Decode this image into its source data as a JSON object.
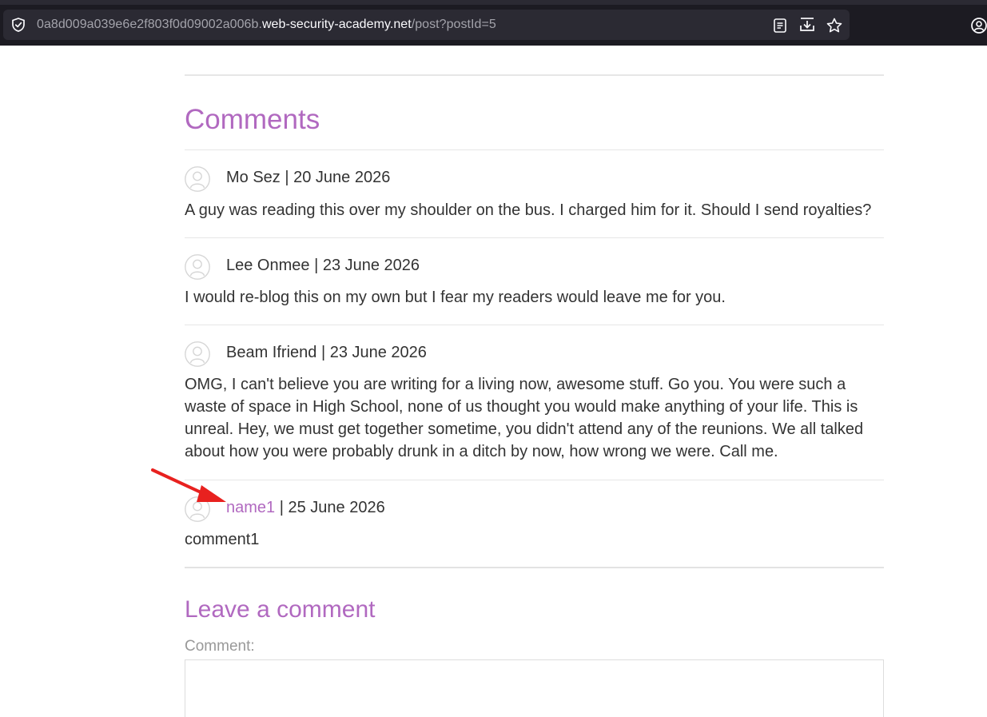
{
  "browser": {
    "url_subdomain": "0a8d009a039e6e2f803f0d09002a006b.",
    "url_host": "web-security-academy.net",
    "url_path": "/post?postId=5"
  },
  "comments_section": {
    "title": "Comments",
    "items": [
      {
        "author": "Mo Sez",
        "separator": " | ",
        "date": "20 June 2026",
        "text": "A guy was reading this over my shoulder on the bus. I charged him for it. Should I send royalties?"
      },
      {
        "author": "Lee Onmee",
        "separator": " | ",
        "date": "23 June 2026",
        "text": "I would re-blog this on my own but I fear my readers would leave me for you."
      },
      {
        "author": "Beam Ifriend",
        "separator": " | ",
        "date": "23 June 2026",
        "text": "OMG, I can't believe you are writing for a living now, awesome stuff. Go you. You were such a waste of space in High School, none of us thought you would make anything of your life. This is unreal. Hey, we must get together sometime, you didn't attend any of the reunions. We all talked about how you were probably drunk in a ditch by now, how wrong we were. Call me."
      },
      {
        "author": "name1",
        "separator": " | ",
        "date": "25 June 2026",
        "text": "comment1"
      }
    ]
  },
  "leave_comment": {
    "title": "Leave a comment",
    "comment_label": "Comment:"
  },
  "colors": {
    "accent": "#b169c0",
    "annotation_arrow": "#e8211f",
    "browser_bar": "#1c1b22"
  },
  "icons": {
    "security": "shield-check-icon",
    "reader_view": "reader-view-icon",
    "save": "download-icon",
    "bookmark": "star-icon",
    "account": "account-icon",
    "avatar": "avatar-icon",
    "annotation": "red-arrow-icon"
  }
}
